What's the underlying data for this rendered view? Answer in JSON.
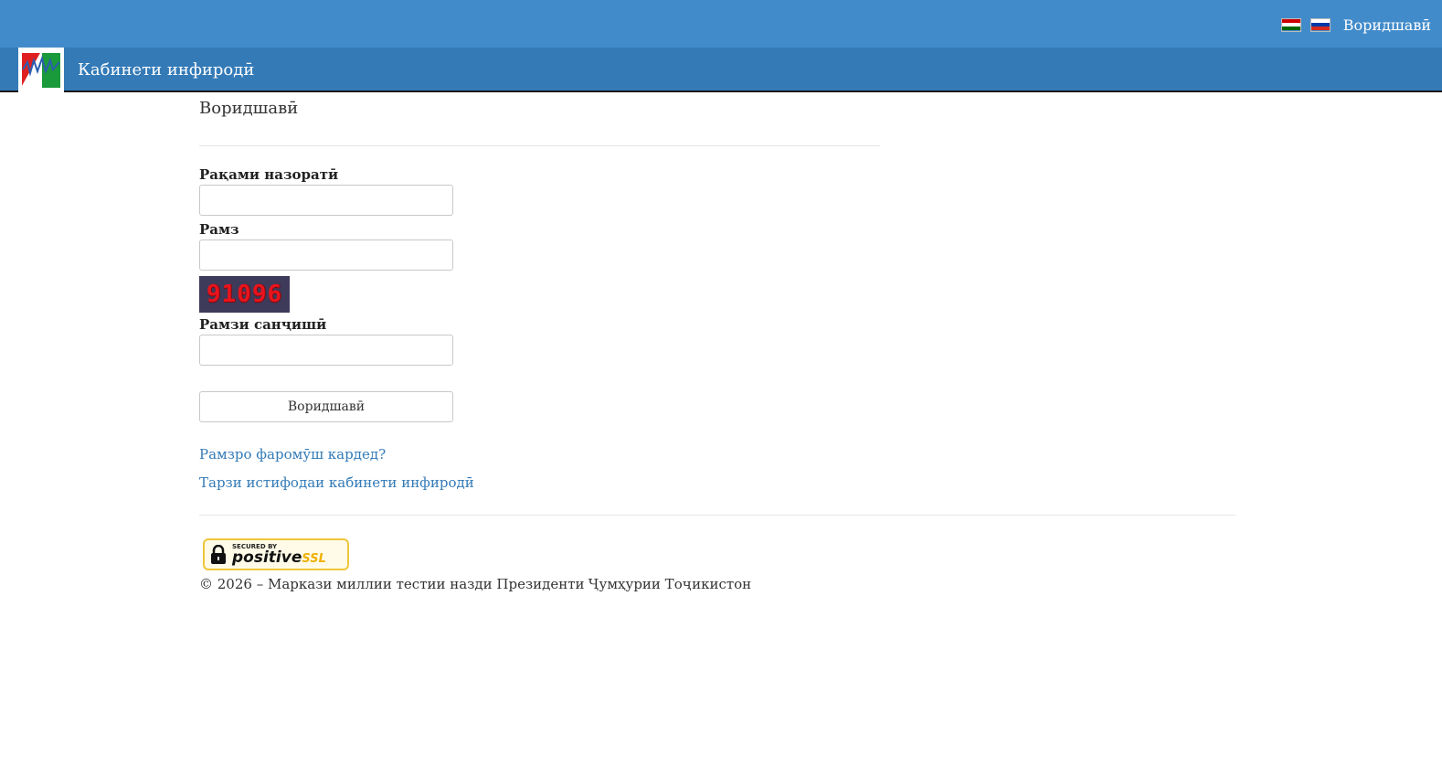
{
  "header": {
    "signin_link": "Воридшавӣ",
    "brand": "Кабинети инфиродӣ",
    "flags": [
      {
        "name": "tajik-flag-icon",
        "colors": [
          "#cc0000",
          "#ffffff",
          "#006600"
        ]
      },
      {
        "name": "russian-flag-icon",
        "colors": [
          "#ffffff",
          "#0039a6",
          "#d52b1e"
        ]
      }
    ]
  },
  "main": {
    "title": "Воридшавӣ",
    "control_number_label": "Рақами назоратӣ",
    "control_number_value": "",
    "password_label": "Рамз",
    "password_value": "",
    "captcha_text": "91096",
    "captcha_code_label": "Рамзи санҷишӣ",
    "captcha_code_value": "",
    "submit_label": "Воридшавӣ",
    "forgot_password_link": "Рамзро фаромӯш кардед?",
    "usage_guide_link": "Тарзи истифодаи кабинети инфиродӣ"
  },
  "footer": {
    "ssl_badge_small": "SECURED BY",
    "ssl_badge_brand": "positive",
    "ssl_badge_suffix": "SSL",
    "copyright": "© 2026 – Маркази миллии тестии назди Президенти Ҷумҳурии Тоҷикистон"
  },
  "colors": {
    "topbar": "#428bca",
    "navbar": "#337ab7",
    "link": "#337ab7"
  }
}
